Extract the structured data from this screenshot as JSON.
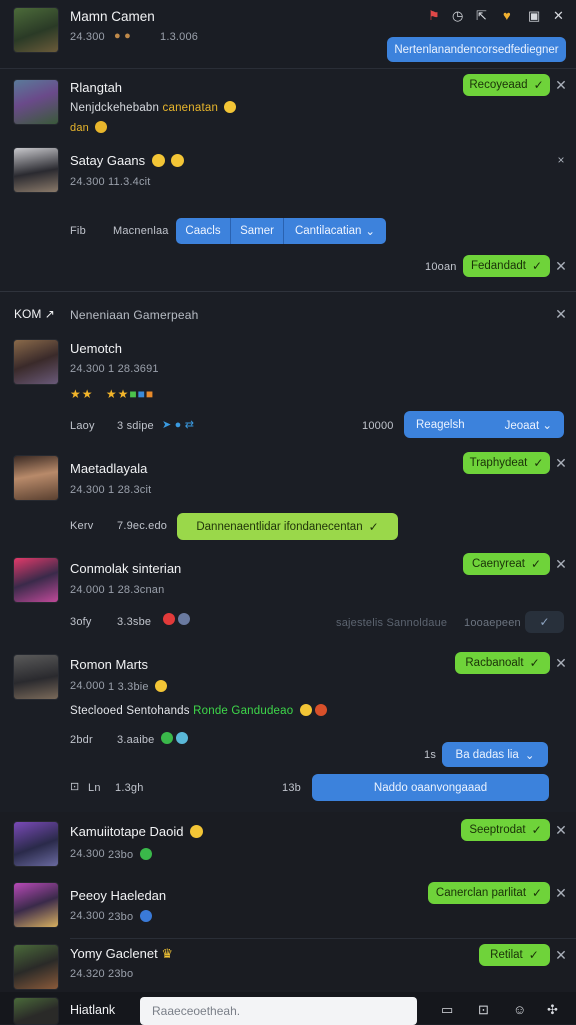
{
  "header": {
    "title": "Mamn Camen",
    "meta": "24.300",
    "meta2": "1.3.006",
    "action_button": "Nertenlanandencorsedfediegner"
  },
  "card1": {
    "name": "Rlangtah",
    "desc": "Nenjdckehebabn",
    "desc_highlight": "canenatan",
    "desc2": "dan",
    "status": "Recoyeaad"
  },
  "card2": {
    "name": "Satay Gaans",
    "meta": "24.300",
    "meta2": "11.3.4cit",
    "label": "Fib",
    "label2": "Macnenlaa",
    "seg": [
      "Caacls",
      "Samer",
      "Cantilacatian"
    ],
    "footer_text": "10oan",
    "status": "Fedandadt"
  },
  "section": {
    "title": "KOM",
    "subtitle": "Neneniaan Gamerpeah"
  },
  "items": [
    {
      "name": "Uemotch",
      "meta": "24.300",
      "meta2": "1 28.3691",
      "tag": "Laoy",
      "tag2": "3 sdipe",
      "right_text": "10000",
      "dropdown_left": "Reagelsh",
      "dropdown_right": "Jeoaat"
    },
    {
      "name": "Maetadlayala",
      "meta": "24.300",
      "meta2": "1 28.3cit",
      "tag": "Kerv",
      "tag2": "7.9ec.edo",
      "status": "Traphydeat",
      "wide_pill": "Dannenaentlidar ifondanecentan"
    },
    {
      "name": "Conmolak sinterian",
      "meta": "24.000",
      "meta2": "1 28.3cnan",
      "tag": "3ofy",
      "tag2": "3.3sbe",
      "faded": "sajestelis Sannoldaue",
      "faded2": "1ooaepeen",
      "status": "Caenyreat"
    },
    {
      "name": "Romon Marts",
      "meta": "24.000",
      "meta2": "1 3.3bie",
      "desc": "Steclooed Sentohands",
      "desc_green": "Ronde Gandudeao",
      "tag": "2bdr",
      "tag2": "3.aaibe",
      "status": "Racbanoalt",
      "small_label": "1s",
      "blue_pill": "Ba dadas lia",
      "row_label": "Ln",
      "row_label2": "1.3gh",
      "row_label3": "13b",
      "wide_blue": "Naddo oaanvongaaad"
    },
    {
      "name": "Kamuiitotape Daoid",
      "meta": "24.300",
      "meta2": "23bo",
      "status": "Seeptrodat"
    },
    {
      "name": "Peeoy Haeledan",
      "meta": "24.300",
      "meta2": "23bo",
      "status": "Canerclan parlitat"
    },
    {
      "name": "Yomy Gaclenet",
      "meta": "24.320",
      "meta2": "23bo",
      "status": "Retilat"
    }
  ],
  "footer": {
    "label": "Hiatlank",
    "input_placeholder": "Raaeceoetheah."
  },
  "colors": {
    "bg": "#1b1e25",
    "green": "#6fd33a",
    "blue": "#3c82dc"
  }
}
